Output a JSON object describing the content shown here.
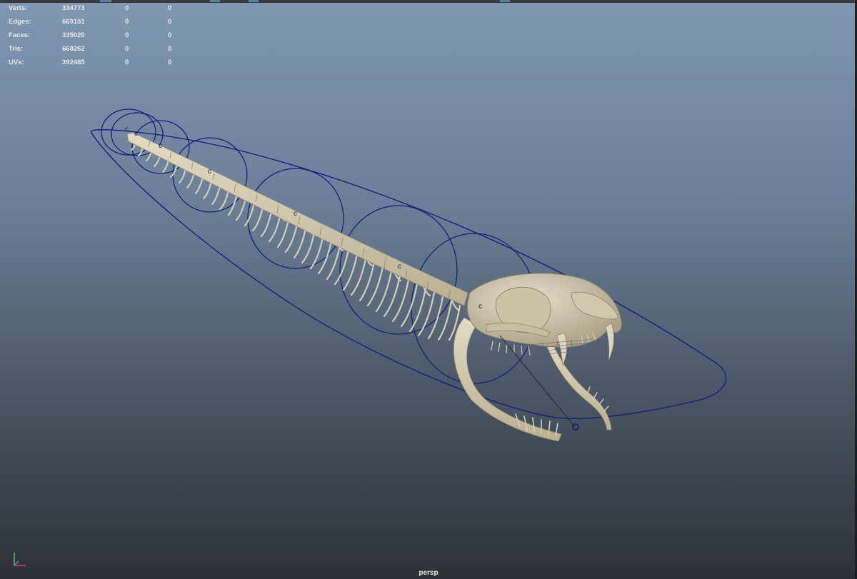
{
  "viewport": {
    "camera": "persp",
    "heads_up": {
      "rows": [
        {
          "label": "Verts:",
          "total": "334773",
          "selected": "0",
          "selected2": "0"
        },
        {
          "label": "Edges:",
          "total": "669151",
          "selected": "0",
          "selected2": "0"
        },
        {
          "label": "Faces:",
          "total": "335020",
          "selected": "0",
          "selected2": "0"
        },
        {
          "label": "Tris:",
          "total": "668262",
          "selected": "0",
          "selected2": "0"
        },
        {
          "label": "UVs:",
          "total": "392485",
          "selected": "0",
          "selected2": "0"
        }
      ]
    },
    "control_letter": "c",
    "colors": {
      "rig_curve": "#101c7a",
      "bone": "#d8cfb4",
      "bone_shadow": "#b4aa8f",
      "gradient_top": "#7f97b1",
      "gradient_bottom": "#2d3137"
    },
    "icons": {
      "axis": "xyz-axis-gizmo-icon"
    }
  }
}
